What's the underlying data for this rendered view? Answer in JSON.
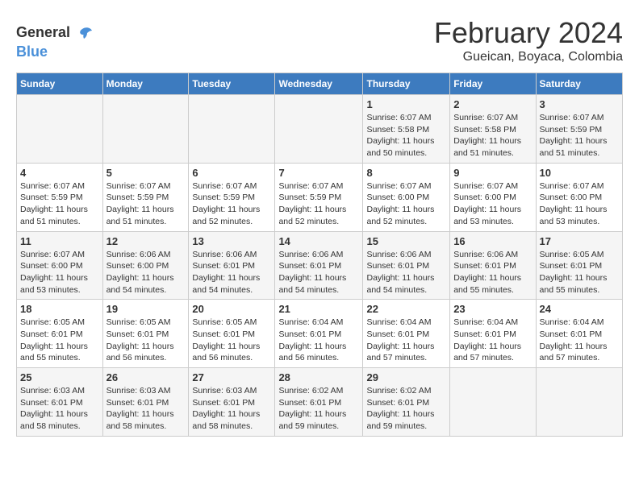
{
  "header": {
    "logo_general": "General",
    "logo_blue": "Blue",
    "month_title": "February 2024",
    "location": "Gueican, Boyaca, Colombia"
  },
  "days_of_week": [
    "Sunday",
    "Monday",
    "Tuesday",
    "Wednesday",
    "Thursday",
    "Friday",
    "Saturday"
  ],
  "weeks": [
    {
      "days": [
        {
          "number": "",
          "info": ""
        },
        {
          "number": "",
          "info": ""
        },
        {
          "number": "",
          "info": ""
        },
        {
          "number": "",
          "info": ""
        },
        {
          "number": "1",
          "sunrise": "6:07 AM",
          "sunset": "5:58 PM",
          "daylight": "11 hours and 50 minutes."
        },
        {
          "number": "2",
          "sunrise": "6:07 AM",
          "sunset": "5:58 PM",
          "daylight": "11 hours and 51 minutes."
        },
        {
          "number": "3",
          "sunrise": "6:07 AM",
          "sunset": "5:59 PM",
          "daylight": "11 hours and 51 minutes."
        }
      ]
    },
    {
      "days": [
        {
          "number": "4",
          "sunrise": "6:07 AM",
          "sunset": "5:59 PM",
          "daylight": "11 hours and 51 minutes."
        },
        {
          "number": "5",
          "sunrise": "6:07 AM",
          "sunset": "5:59 PM",
          "daylight": "11 hours and 51 minutes."
        },
        {
          "number": "6",
          "sunrise": "6:07 AM",
          "sunset": "5:59 PM",
          "daylight": "11 hours and 52 minutes."
        },
        {
          "number": "7",
          "sunrise": "6:07 AM",
          "sunset": "5:59 PM",
          "daylight": "11 hours and 52 minutes."
        },
        {
          "number": "8",
          "sunrise": "6:07 AM",
          "sunset": "6:00 PM",
          "daylight": "11 hours and 52 minutes."
        },
        {
          "number": "9",
          "sunrise": "6:07 AM",
          "sunset": "6:00 PM",
          "daylight": "11 hours and 53 minutes."
        },
        {
          "number": "10",
          "sunrise": "6:07 AM",
          "sunset": "6:00 PM",
          "daylight": "11 hours and 53 minutes."
        }
      ]
    },
    {
      "days": [
        {
          "number": "11",
          "sunrise": "6:07 AM",
          "sunset": "6:00 PM",
          "daylight": "11 hours and 53 minutes."
        },
        {
          "number": "12",
          "sunrise": "6:06 AM",
          "sunset": "6:00 PM",
          "daylight": "11 hours and 54 minutes."
        },
        {
          "number": "13",
          "sunrise": "6:06 AM",
          "sunset": "6:01 PM",
          "daylight": "11 hours and 54 minutes."
        },
        {
          "number": "14",
          "sunrise": "6:06 AM",
          "sunset": "6:01 PM",
          "daylight": "11 hours and 54 minutes."
        },
        {
          "number": "15",
          "sunrise": "6:06 AM",
          "sunset": "6:01 PM",
          "daylight": "11 hours and 54 minutes."
        },
        {
          "number": "16",
          "sunrise": "6:06 AM",
          "sunset": "6:01 PM",
          "daylight": "11 hours and 55 minutes."
        },
        {
          "number": "17",
          "sunrise": "6:05 AM",
          "sunset": "6:01 PM",
          "daylight": "11 hours and 55 minutes."
        }
      ]
    },
    {
      "days": [
        {
          "number": "18",
          "sunrise": "6:05 AM",
          "sunset": "6:01 PM",
          "daylight": "11 hours and 55 minutes."
        },
        {
          "number": "19",
          "sunrise": "6:05 AM",
          "sunset": "6:01 PM",
          "daylight": "11 hours and 56 minutes."
        },
        {
          "number": "20",
          "sunrise": "6:05 AM",
          "sunset": "6:01 PM",
          "daylight": "11 hours and 56 minutes."
        },
        {
          "number": "21",
          "sunrise": "6:04 AM",
          "sunset": "6:01 PM",
          "daylight": "11 hours and 56 minutes."
        },
        {
          "number": "22",
          "sunrise": "6:04 AM",
          "sunset": "6:01 PM",
          "daylight": "11 hours and 57 minutes."
        },
        {
          "number": "23",
          "sunrise": "6:04 AM",
          "sunset": "6:01 PM",
          "daylight": "11 hours and 57 minutes."
        },
        {
          "number": "24",
          "sunrise": "6:04 AM",
          "sunset": "6:01 PM",
          "daylight": "11 hours and 57 minutes."
        }
      ]
    },
    {
      "days": [
        {
          "number": "25",
          "sunrise": "6:03 AM",
          "sunset": "6:01 PM",
          "daylight": "11 hours and 58 minutes."
        },
        {
          "number": "26",
          "sunrise": "6:03 AM",
          "sunset": "6:01 PM",
          "daylight": "11 hours and 58 minutes."
        },
        {
          "number": "27",
          "sunrise": "6:03 AM",
          "sunset": "6:01 PM",
          "daylight": "11 hours and 58 minutes."
        },
        {
          "number": "28",
          "sunrise": "6:02 AM",
          "sunset": "6:01 PM",
          "daylight": "11 hours and 59 minutes."
        },
        {
          "number": "29",
          "sunrise": "6:02 AM",
          "sunset": "6:01 PM",
          "daylight": "11 hours and 59 minutes."
        },
        {
          "number": "",
          "info": ""
        },
        {
          "number": "",
          "info": ""
        }
      ]
    }
  ]
}
